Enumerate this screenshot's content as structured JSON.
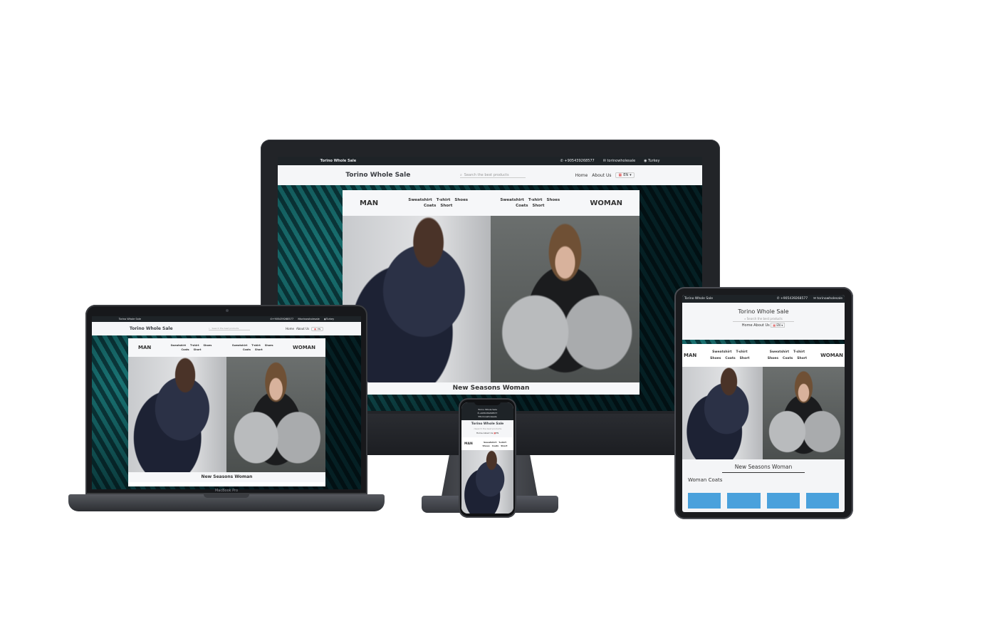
{
  "site": {
    "brand": "Torino Whole Sale",
    "phone": "+905439268577",
    "email": "torinowholesale",
    "country": "Turkey",
    "search_placeholder": "Search the best products",
    "nav": {
      "home": "Home",
      "about": "About Us"
    },
    "lang": "EN",
    "man": "MAN",
    "woman": "WOMAN",
    "man_cats": [
      "Sweatshirt",
      "T-shirt",
      "Shoes",
      "Coats",
      "Short"
    ],
    "woman_cats": [
      "Sweatshirt",
      "T-shirt",
      "Shoes",
      "Coats",
      "Short"
    ],
    "season_title": "New Seasons Woman",
    "section_title": "Woman Coats"
  },
  "laptop": {
    "model_label": "MacBook Pro"
  },
  "colors": {
    "accent_blue": "#4aa1dc",
    "topbar": "#1e2327",
    "hero_teal": "#1f6868"
  },
  "icons": [
    "whatsapp-icon",
    "mail-icon",
    "globe-icon",
    "search-icon",
    "flag-icon",
    "caret-down-icon"
  ]
}
